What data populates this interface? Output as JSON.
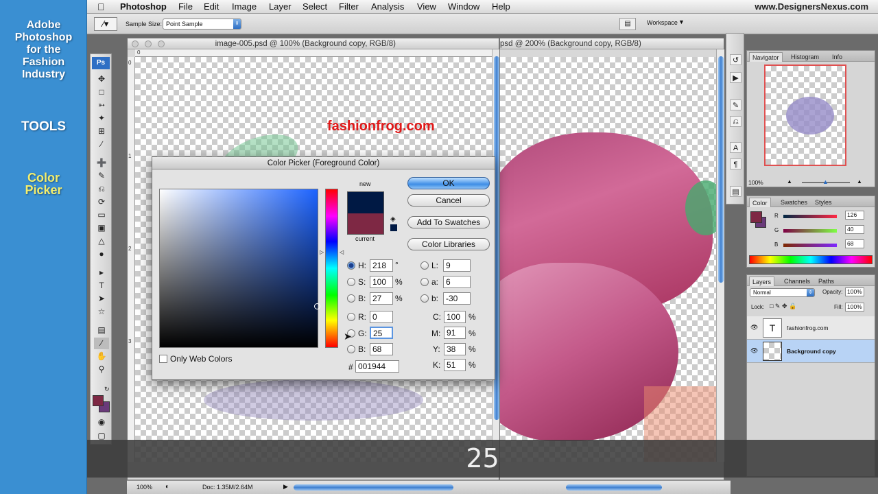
{
  "tutorial": {
    "title_lines": [
      "Adobe",
      "Photoshop",
      "for the",
      "Fashion",
      "Industry"
    ],
    "section": "TOOLS",
    "topic_lines": [
      "Color",
      "Picker"
    ]
  },
  "menubar": {
    "app": "Photoshop",
    "items": [
      "File",
      "Edit",
      "Image",
      "Layer",
      "Select",
      "Filter",
      "Analysis",
      "View",
      "Window",
      "Help"
    ],
    "site": "www.DesignersNexus.com"
  },
  "options": {
    "sample_size_label": "Sample Size:",
    "sample_size_value": "Point Sample",
    "workspace_label": "Workspace"
  },
  "documents": {
    "doc1_title": "image-005.psd @ 100% (Background copy, RGB/8)",
    "doc2_title": "psd @ 200% (Background copy, RGB/8)",
    "watermark": "fashionfrog.com"
  },
  "navigator": {
    "tabs": [
      "Navigator",
      "Histogram",
      "Info"
    ],
    "zoom": "100%"
  },
  "color_panel": {
    "tabs": [
      "Color",
      "Swatches",
      "Styles"
    ],
    "r_label": "R",
    "g_label": "G",
    "b_label": "B",
    "r": "126",
    "g": "40",
    "b": "68",
    "foreground": "#7e2844",
    "background": "#6a3a7a"
  },
  "layers": {
    "tabs": [
      "Layers",
      "Channels",
      "Paths"
    ],
    "blend_mode": "Normal",
    "opacity_label": "Opacity:",
    "opacity": "100%",
    "lock_label": "Lock:",
    "fill_label": "Fill:",
    "fill": "100%",
    "items": [
      {
        "name": "fashionfrog.com",
        "thumb": "T"
      },
      {
        "name": "Background copy",
        "thumb": ""
      }
    ]
  },
  "picker": {
    "title": "Color Picker (Foreground Color)",
    "new_label": "new",
    "current_label": "current",
    "new_color": "#001944",
    "current_color": "#7e2844",
    "buttons": {
      "ok": "OK",
      "cancel": "Cancel",
      "add_swatches": "Add To Swatches",
      "libraries": "Color Libraries"
    },
    "fields": {
      "H": {
        "label": "H:",
        "value": "218",
        "unit": "°"
      },
      "S": {
        "label": "S:",
        "value": "100",
        "unit": "%"
      },
      "Bv": {
        "label": "B:",
        "value": "27",
        "unit": "%"
      },
      "R": {
        "label": "R:",
        "value": "0"
      },
      "G": {
        "label": "G:",
        "value": "25"
      },
      "Bc": {
        "label": "B:",
        "value": "68"
      },
      "L": {
        "label": "L:",
        "value": "9"
      },
      "a": {
        "label": "a:",
        "value": "6"
      },
      "b": {
        "label": "b:",
        "value": "-30"
      },
      "C": {
        "label": "C:",
        "value": "100",
        "unit": "%"
      },
      "M": {
        "label": "M:",
        "value": "91",
        "unit": "%"
      },
      "Y": {
        "label": "Y:",
        "value": "38",
        "unit": "%"
      },
      "K": {
        "label": "K:",
        "value": "51",
        "unit": "%"
      }
    },
    "hex_label": "#",
    "hex": "001944",
    "web_only_label": "Only Web Colors"
  },
  "caption": "25",
  "status": {
    "zoom": "100%",
    "doc": "Doc: 1.35M/2.64M"
  }
}
